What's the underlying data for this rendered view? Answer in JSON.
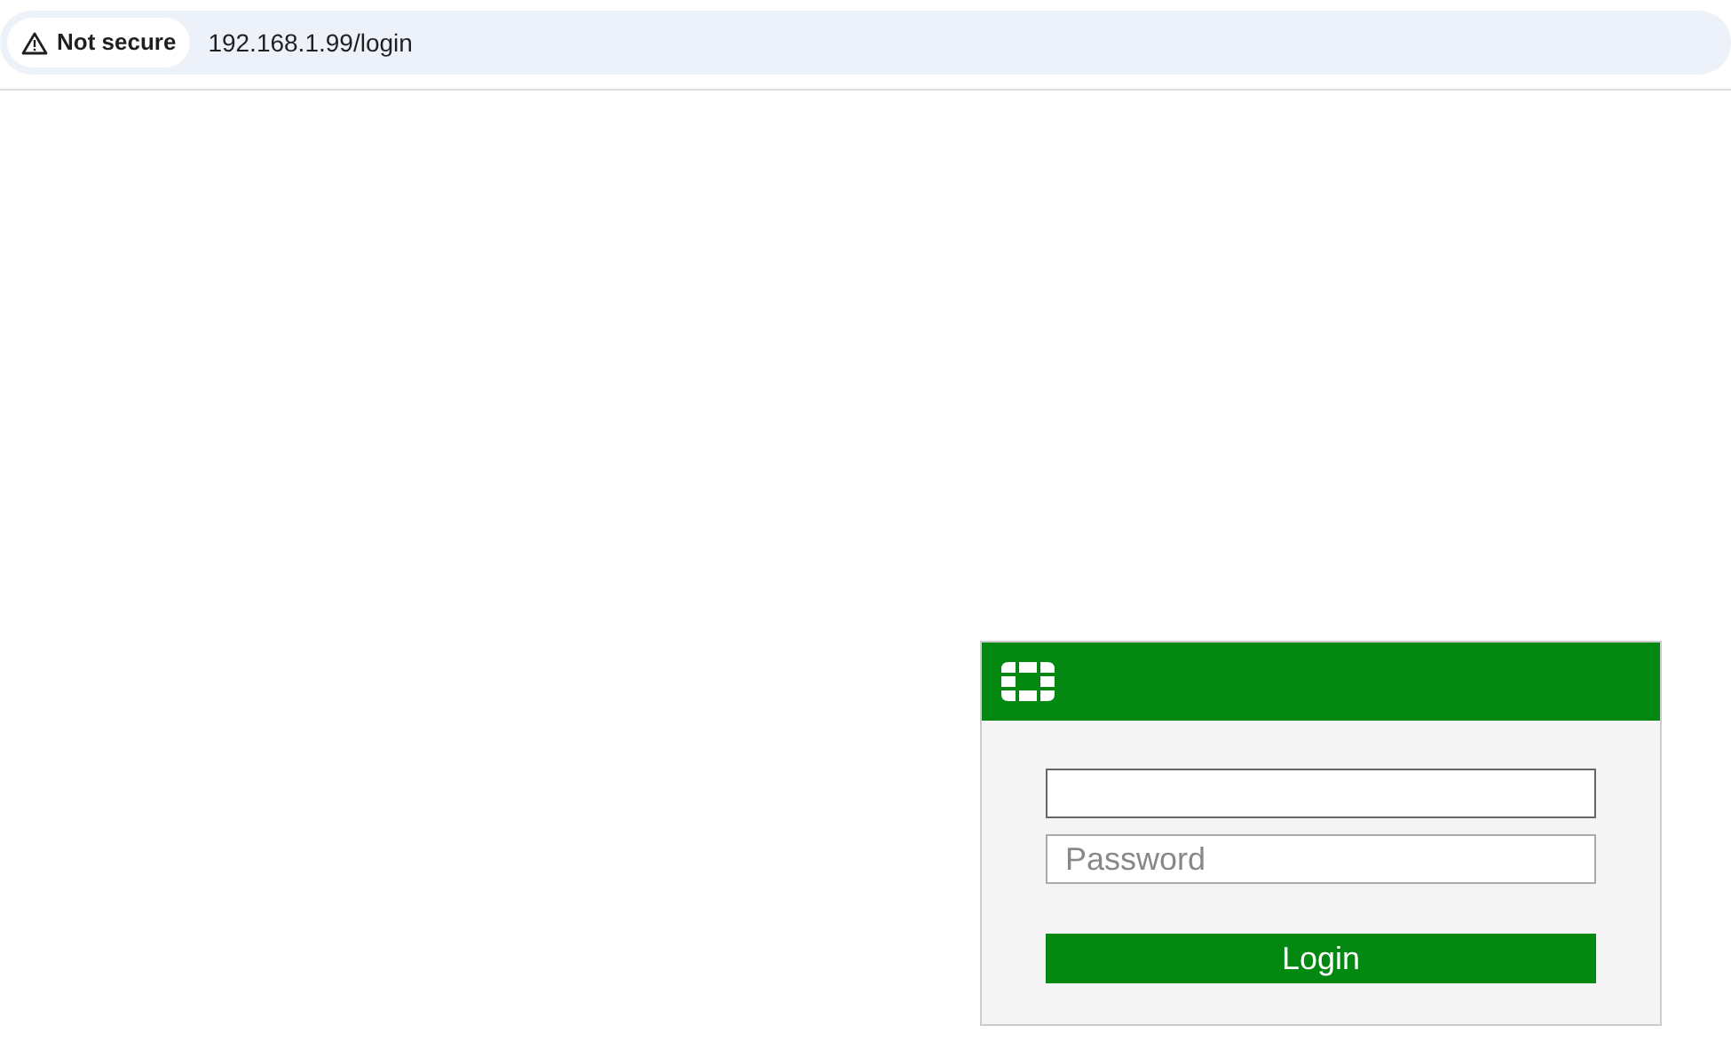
{
  "address_bar": {
    "security_label": "Not secure",
    "url": "192.168.1.99/login"
  },
  "login_form": {
    "fields": [
      {
        "focused": true
      },
      {
        "placeholder": "Password",
        "focused": false
      }
    ],
    "button": "Login"
  }
}
